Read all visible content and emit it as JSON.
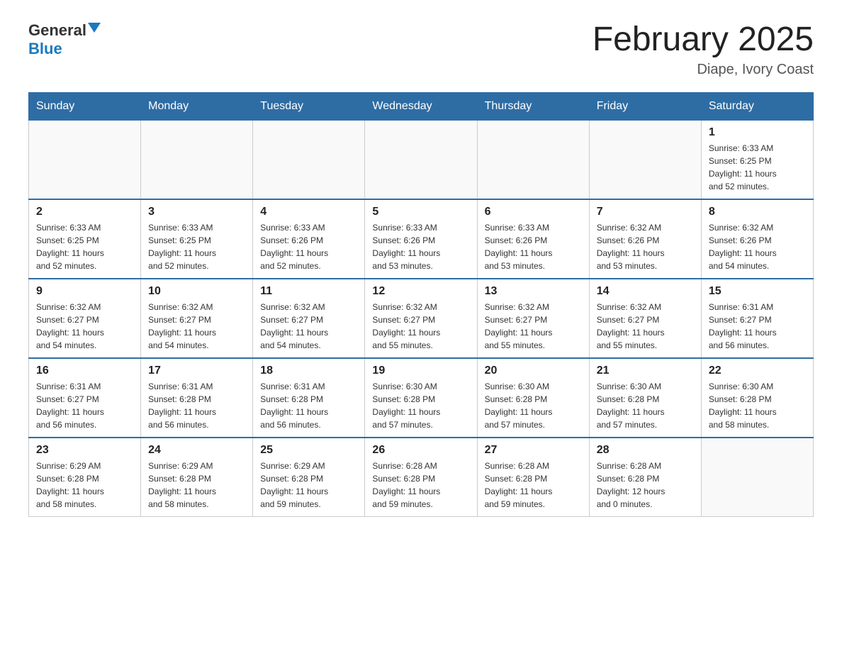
{
  "header": {
    "logo_general": "General",
    "logo_blue": "Blue",
    "month_title": "February 2025",
    "location": "Diape, Ivory Coast"
  },
  "weekdays": [
    "Sunday",
    "Monday",
    "Tuesday",
    "Wednesday",
    "Thursday",
    "Friday",
    "Saturday"
  ],
  "weeks": [
    [
      {
        "day": "",
        "info": ""
      },
      {
        "day": "",
        "info": ""
      },
      {
        "day": "",
        "info": ""
      },
      {
        "day": "",
        "info": ""
      },
      {
        "day": "",
        "info": ""
      },
      {
        "day": "",
        "info": ""
      },
      {
        "day": "1",
        "info": "Sunrise: 6:33 AM\nSunset: 6:25 PM\nDaylight: 11 hours\nand 52 minutes."
      }
    ],
    [
      {
        "day": "2",
        "info": "Sunrise: 6:33 AM\nSunset: 6:25 PM\nDaylight: 11 hours\nand 52 minutes."
      },
      {
        "day": "3",
        "info": "Sunrise: 6:33 AM\nSunset: 6:25 PM\nDaylight: 11 hours\nand 52 minutes."
      },
      {
        "day": "4",
        "info": "Sunrise: 6:33 AM\nSunset: 6:26 PM\nDaylight: 11 hours\nand 52 minutes."
      },
      {
        "day": "5",
        "info": "Sunrise: 6:33 AM\nSunset: 6:26 PM\nDaylight: 11 hours\nand 53 minutes."
      },
      {
        "day": "6",
        "info": "Sunrise: 6:33 AM\nSunset: 6:26 PM\nDaylight: 11 hours\nand 53 minutes."
      },
      {
        "day": "7",
        "info": "Sunrise: 6:32 AM\nSunset: 6:26 PM\nDaylight: 11 hours\nand 53 minutes."
      },
      {
        "day": "8",
        "info": "Sunrise: 6:32 AM\nSunset: 6:26 PM\nDaylight: 11 hours\nand 54 minutes."
      }
    ],
    [
      {
        "day": "9",
        "info": "Sunrise: 6:32 AM\nSunset: 6:27 PM\nDaylight: 11 hours\nand 54 minutes."
      },
      {
        "day": "10",
        "info": "Sunrise: 6:32 AM\nSunset: 6:27 PM\nDaylight: 11 hours\nand 54 minutes."
      },
      {
        "day": "11",
        "info": "Sunrise: 6:32 AM\nSunset: 6:27 PM\nDaylight: 11 hours\nand 54 minutes."
      },
      {
        "day": "12",
        "info": "Sunrise: 6:32 AM\nSunset: 6:27 PM\nDaylight: 11 hours\nand 55 minutes."
      },
      {
        "day": "13",
        "info": "Sunrise: 6:32 AM\nSunset: 6:27 PM\nDaylight: 11 hours\nand 55 minutes."
      },
      {
        "day": "14",
        "info": "Sunrise: 6:32 AM\nSunset: 6:27 PM\nDaylight: 11 hours\nand 55 minutes."
      },
      {
        "day": "15",
        "info": "Sunrise: 6:31 AM\nSunset: 6:27 PM\nDaylight: 11 hours\nand 56 minutes."
      }
    ],
    [
      {
        "day": "16",
        "info": "Sunrise: 6:31 AM\nSunset: 6:27 PM\nDaylight: 11 hours\nand 56 minutes."
      },
      {
        "day": "17",
        "info": "Sunrise: 6:31 AM\nSunset: 6:28 PM\nDaylight: 11 hours\nand 56 minutes."
      },
      {
        "day": "18",
        "info": "Sunrise: 6:31 AM\nSunset: 6:28 PM\nDaylight: 11 hours\nand 56 minutes."
      },
      {
        "day": "19",
        "info": "Sunrise: 6:30 AM\nSunset: 6:28 PM\nDaylight: 11 hours\nand 57 minutes."
      },
      {
        "day": "20",
        "info": "Sunrise: 6:30 AM\nSunset: 6:28 PM\nDaylight: 11 hours\nand 57 minutes."
      },
      {
        "day": "21",
        "info": "Sunrise: 6:30 AM\nSunset: 6:28 PM\nDaylight: 11 hours\nand 57 minutes."
      },
      {
        "day": "22",
        "info": "Sunrise: 6:30 AM\nSunset: 6:28 PM\nDaylight: 11 hours\nand 58 minutes."
      }
    ],
    [
      {
        "day": "23",
        "info": "Sunrise: 6:29 AM\nSunset: 6:28 PM\nDaylight: 11 hours\nand 58 minutes."
      },
      {
        "day": "24",
        "info": "Sunrise: 6:29 AM\nSunset: 6:28 PM\nDaylight: 11 hours\nand 58 minutes."
      },
      {
        "day": "25",
        "info": "Sunrise: 6:29 AM\nSunset: 6:28 PM\nDaylight: 11 hours\nand 59 minutes."
      },
      {
        "day": "26",
        "info": "Sunrise: 6:28 AM\nSunset: 6:28 PM\nDaylight: 11 hours\nand 59 minutes."
      },
      {
        "day": "27",
        "info": "Sunrise: 6:28 AM\nSunset: 6:28 PM\nDaylight: 11 hours\nand 59 minutes."
      },
      {
        "day": "28",
        "info": "Sunrise: 6:28 AM\nSunset: 6:28 PM\nDaylight: 12 hours\nand 0 minutes."
      },
      {
        "day": "",
        "info": ""
      }
    ]
  ]
}
